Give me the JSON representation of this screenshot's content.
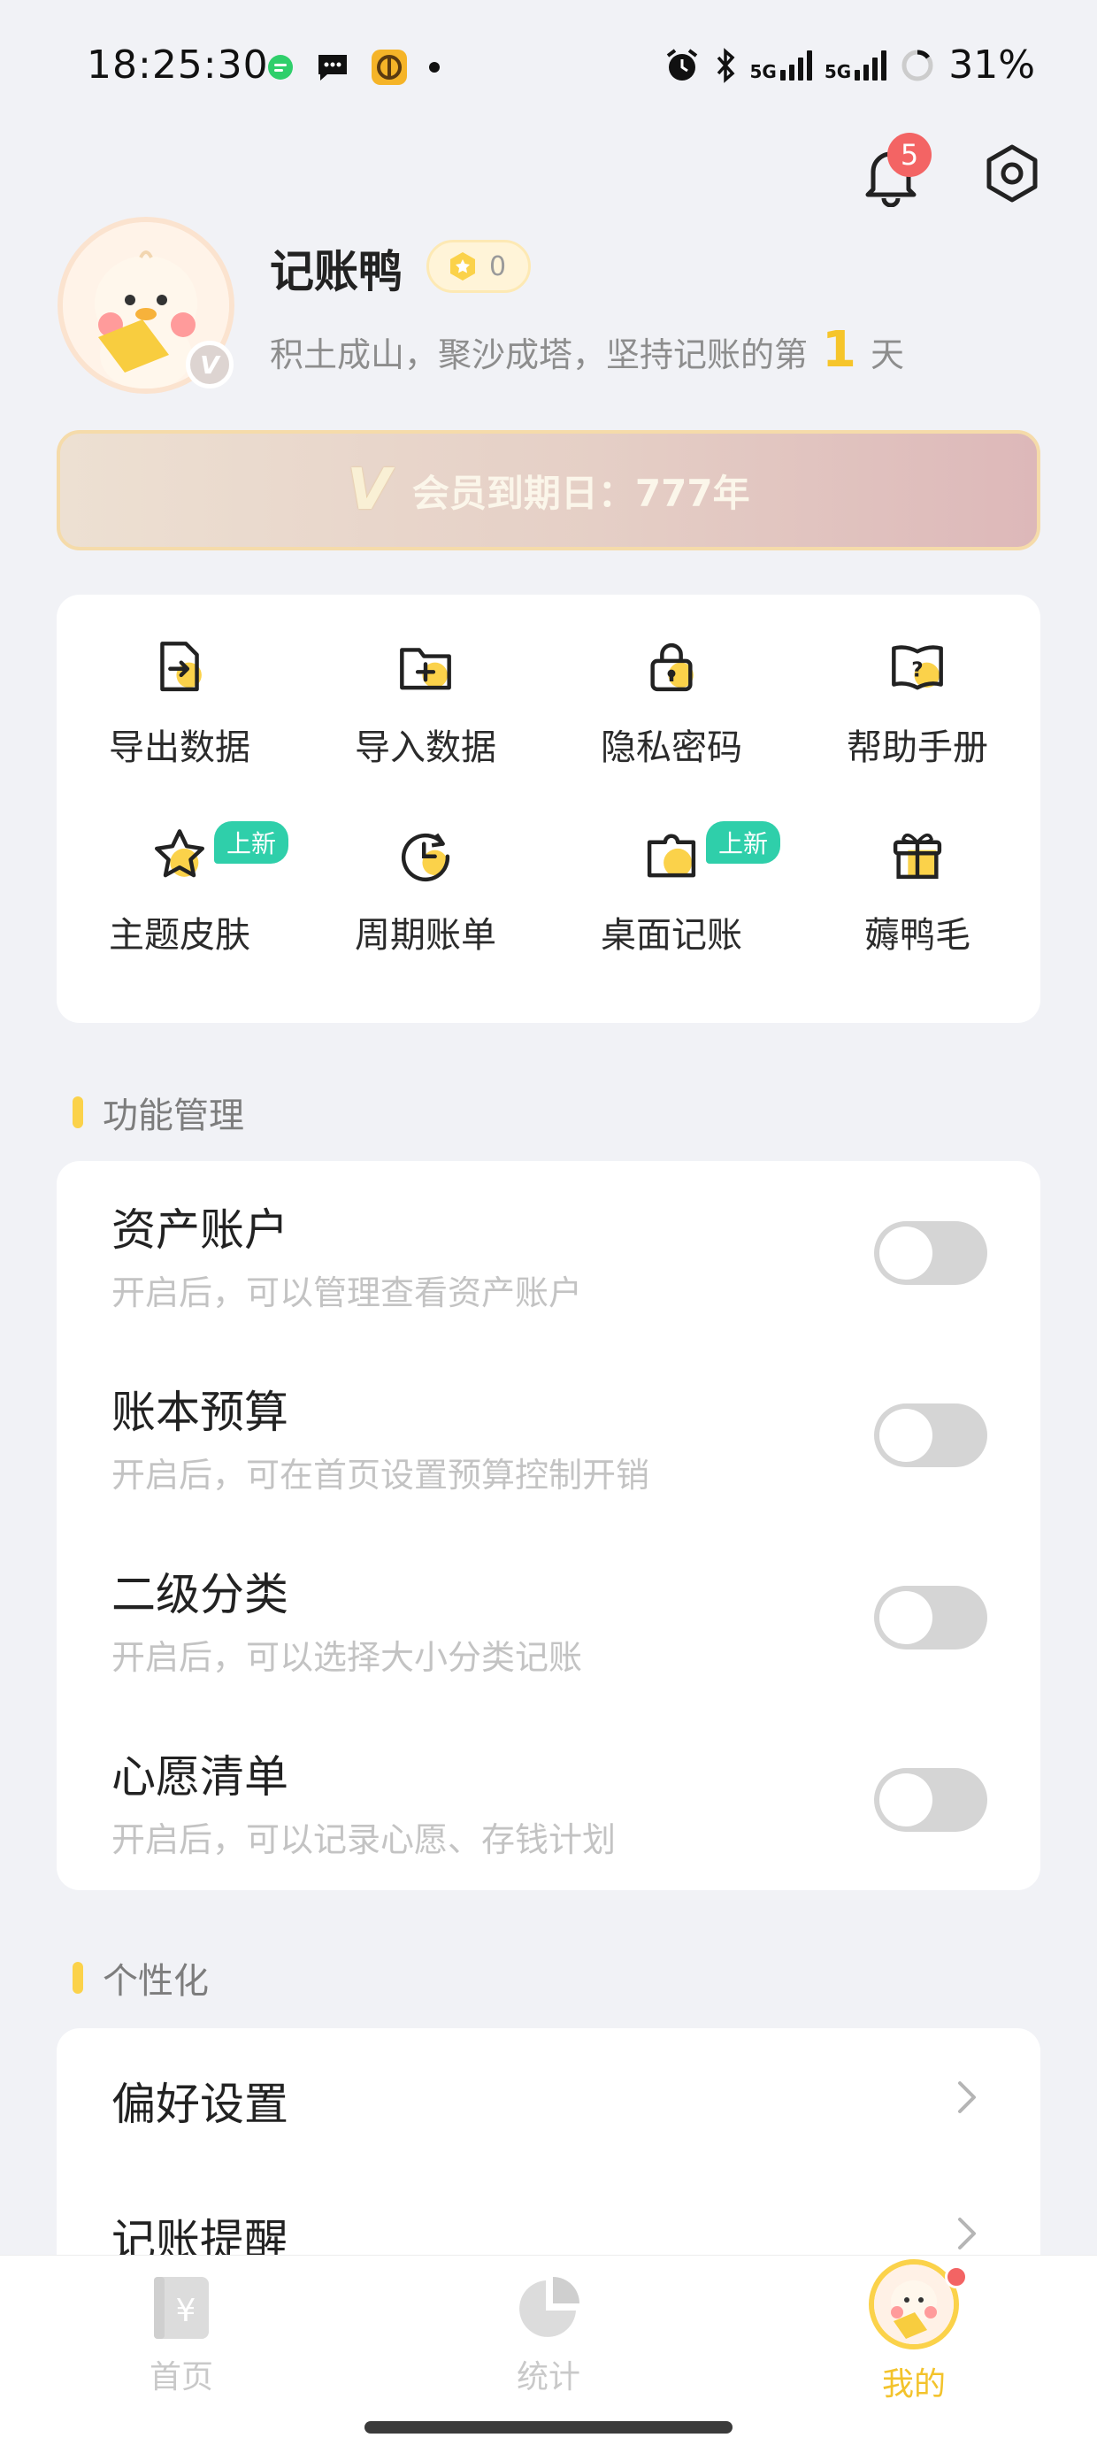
{
  "status_bar": {
    "time": "18:25:30",
    "battery": "31%",
    "net1": "5G",
    "net2": "5G"
  },
  "header": {
    "notification_count": "5"
  },
  "profile": {
    "nickname": "记账鸭",
    "coin_count": "0",
    "motto_prefix": "积土成山，聚沙成塔，坚持记账的第",
    "days": "1",
    "motto_suffix": "天",
    "vip_mark": "V"
  },
  "vip_banner": {
    "v": "V",
    "text": "会员到期日：777年"
  },
  "grid": {
    "items": [
      {
        "label": "导出数据"
      },
      {
        "label": "导入数据"
      },
      {
        "label": "隐私密码"
      },
      {
        "label": "帮助手册"
      },
      {
        "label": "主题皮肤",
        "badge": "上新"
      },
      {
        "label": "周期账单"
      },
      {
        "label": "桌面记账",
        "badge": "上新"
      },
      {
        "label": "薅鸭毛"
      }
    ]
  },
  "sections": {
    "features": "功能管理",
    "personal": "个性化"
  },
  "features": [
    {
      "title": "资产账户",
      "desc": "开启后，可以管理查看资产账户"
    },
    {
      "title": "账本预算",
      "desc": "开启后，可在首页设置预算控制开销"
    },
    {
      "title": "二级分类",
      "desc": "开启后，可以选择大小分类记账"
    },
    {
      "title": "心愿清单",
      "desc": "开启后，可以记录心愿、存钱计划"
    }
  ],
  "personal": [
    {
      "label": "偏好设置"
    },
    {
      "label": "记账提醒"
    }
  ],
  "tabbar": {
    "tabs": [
      {
        "label": "首页"
      },
      {
        "label": "统计"
      },
      {
        "label": "我的"
      }
    ],
    "home_icon_text": "¥"
  },
  "colors": {
    "accent": "#f6c52a",
    "badge_red": "#f36464",
    "new_badge": "#2fcfaa"
  }
}
